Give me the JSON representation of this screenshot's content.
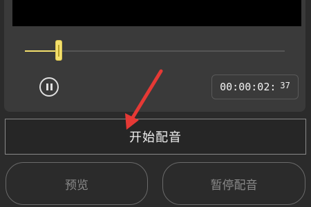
{
  "player": {
    "progress_fraction": 0.13,
    "time_main": "00:00:02:",
    "time_ms": "37"
  },
  "buttons": {
    "start_dubbing": "开始配音",
    "preview": "预览",
    "pause_dubbing": "暂停配音"
  },
  "colors": {
    "accent_yellow": "#f4e06d",
    "annotation_arrow": "#e53935"
  },
  "icons": {
    "play_pause": "pause-icon"
  }
}
